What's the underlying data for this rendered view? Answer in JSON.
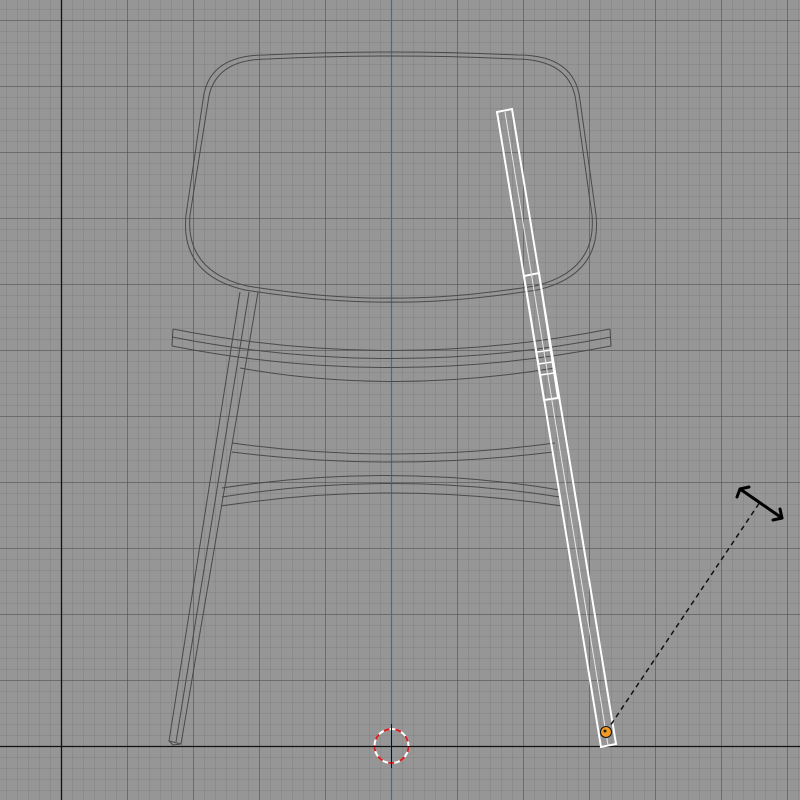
{
  "viewport": {
    "view": "front-orthographic",
    "colors": {
      "background": "#969696",
      "grid_minor": "#7d7d7d",
      "grid_major": "#646464",
      "axis_horizontal": "#111111",
      "axis_vertical_z": "#2f6fb5",
      "wireframe": "#4a4a4a",
      "selection": "#ffffff",
      "origin_point": "#f59a23",
      "cursor_red": "#d62020"
    },
    "objects": [
      {
        "name": "chair-backrest",
        "selected": false
      },
      {
        "name": "chair-seat",
        "selected": false
      },
      {
        "name": "chair-front-left-leg",
        "selected": false
      },
      {
        "name": "chair-stretcher-rails",
        "selected": false
      },
      {
        "name": "chair-right-leg",
        "selected": true
      }
    ],
    "tool": {
      "name": "rotate",
      "pivot_icon": "pivot-origin-icon",
      "handle_icon": "rotate-arrows-icon"
    },
    "cursor_icon": "3d-cursor-icon"
  }
}
